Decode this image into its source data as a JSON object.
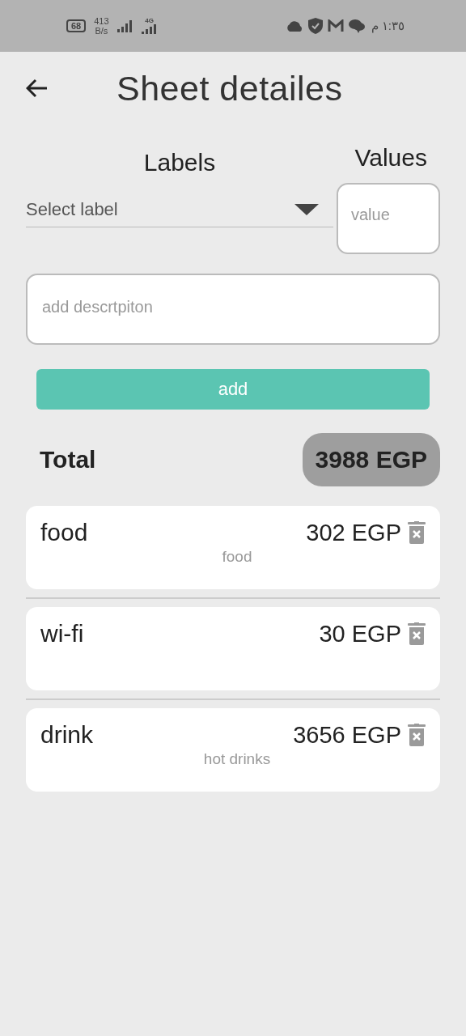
{
  "status_bar": {
    "battery": "68",
    "speed": "413",
    "speed_unit": "B/s",
    "network": "4G",
    "time": "١:٣٥ م"
  },
  "header": {
    "title": "Sheet detailes"
  },
  "form": {
    "labels_heading": "Labels",
    "values_heading": "Values",
    "label_select": {
      "placeholder": "Select label"
    },
    "value_field": {
      "placeholder": "value"
    },
    "description_field": {
      "placeholder": "add descrtpiton"
    },
    "add_button": "add"
  },
  "total": {
    "label": "Total",
    "amount": "3988 EGP"
  },
  "entries": [
    {
      "name": "food",
      "amount": "302 EGP",
      "description": "food"
    },
    {
      "name": "wi-fi",
      "amount": "30 EGP"
    },
    {
      "name": "drink",
      "amount": "3656 EGP",
      "description": "hot drinks"
    }
  ]
}
